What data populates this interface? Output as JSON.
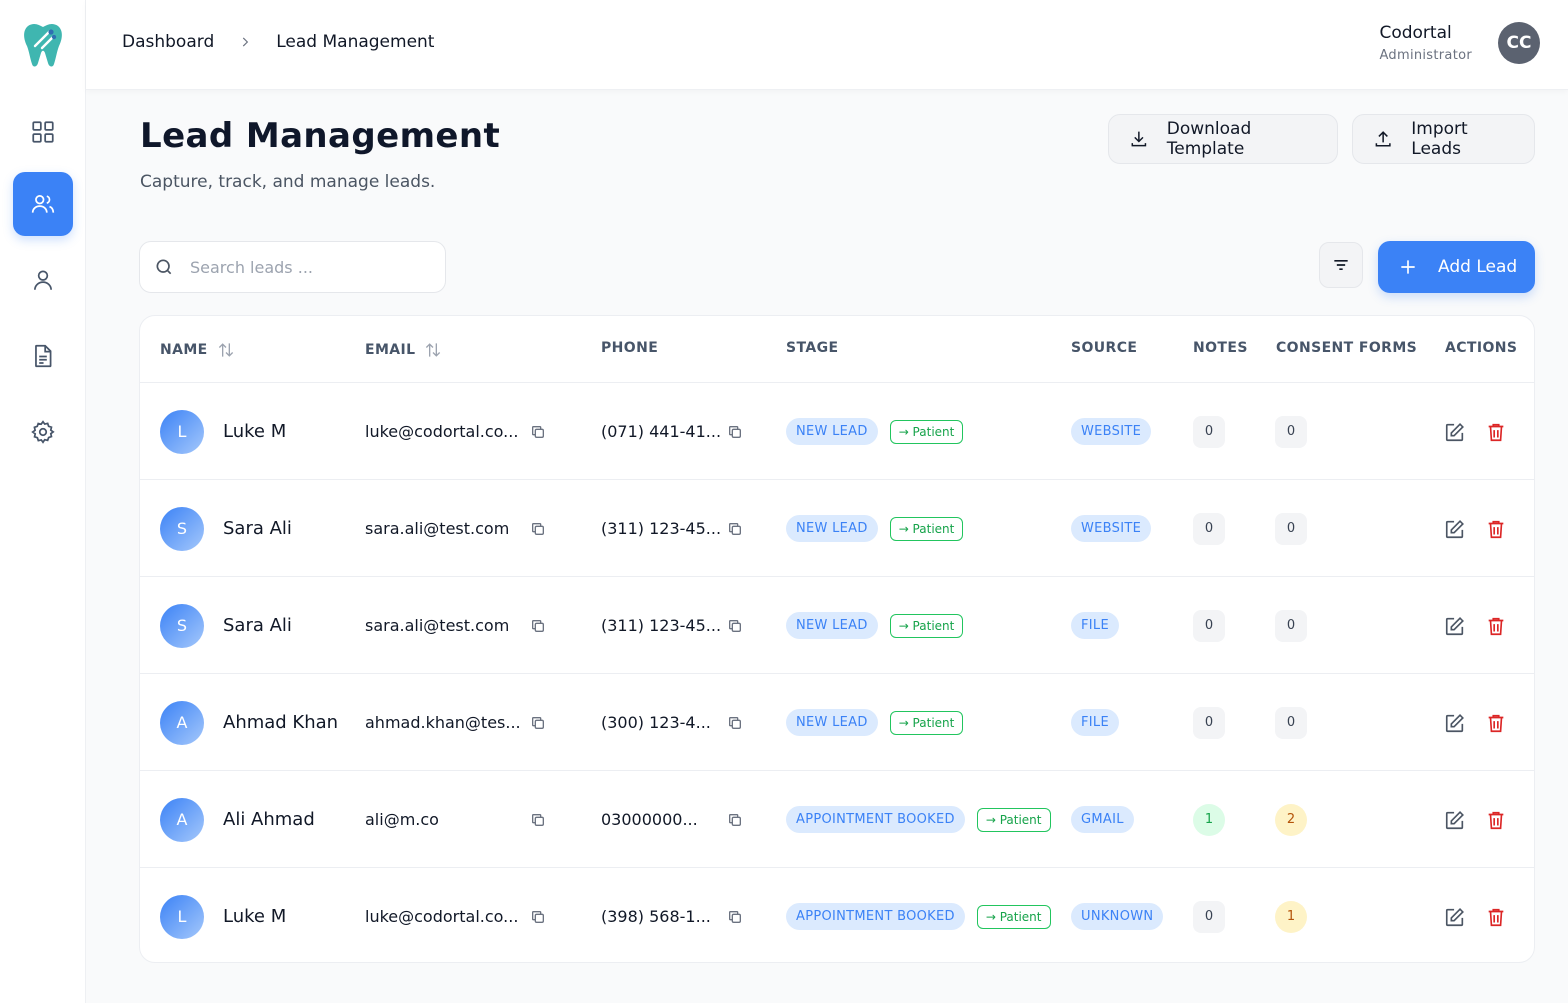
{
  "header": {
    "breadcrumb": [
      "Dashboard",
      "Lead Management"
    ],
    "user": {
      "name": "Codortal",
      "role": "Administrator",
      "initials": "CC"
    }
  },
  "sidebar": {
    "items": [
      {
        "name": "dashboard",
        "icon": "grid-icon",
        "active": false
      },
      {
        "name": "leads",
        "icon": "users-icon",
        "active": true
      },
      {
        "name": "patients",
        "icon": "user-icon",
        "active": false
      },
      {
        "name": "documents",
        "icon": "document-icon",
        "active": false
      },
      {
        "name": "settings",
        "icon": "gear-icon",
        "active": false
      }
    ]
  },
  "page": {
    "title": "Lead Management",
    "subtitle": "Capture, track, and manage leads.",
    "download_label": "Download Template",
    "import_label": "Import Leads",
    "add_label": "Add Lead"
  },
  "search": {
    "placeholder": "Search leads ...",
    "value": ""
  },
  "table": {
    "columns": [
      "NAME",
      "EMAIL",
      "PHONE",
      "STAGE",
      "SOURCE",
      "NOTES",
      "CONSENT FORMS",
      "ACTIONS"
    ],
    "rows": [
      {
        "initial": "L",
        "name": "Luke M",
        "email": "luke@codortal.co...",
        "phone": "(071) 441-41...",
        "stage": "NEW LEAD",
        "patient": "→ Patient",
        "source": "WEBSITE",
        "notes": "0",
        "consent": "0"
      },
      {
        "initial": "S",
        "name": "Sara Ali",
        "email": "sara.ali@test.com",
        "phone": "(311) 123-45...",
        "stage": "NEW LEAD",
        "patient": "→ Patient",
        "source": "WEBSITE",
        "notes": "0",
        "consent": "0"
      },
      {
        "initial": "S",
        "name": "Sara Ali",
        "email": "sara.ali@test.com",
        "phone": "(311) 123-45...",
        "stage": "NEW LEAD",
        "patient": "→ Patient",
        "source": "FILE",
        "notes": "0",
        "consent": "0"
      },
      {
        "initial": "A",
        "name": "Ahmad Khan",
        "email": "ahmad.khan@tes...",
        "phone": "(300) 123-4...",
        "stage": "NEW LEAD",
        "patient": "→ Patient",
        "source": "FILE",
        "notes": "0",
        "consent": "0"
      },
      {
        "initial": "A",
        "name": "Ali Ahmad",
        "email": "ali@m.co",
        "phone": "03000000...",
        "stage": "APPOINTMENT BOOKED",
        "patient": "→ Patient",
        "source": "GMAIL",
        "notes": "1",
        "consent": "2"
      },
      {
        "initial": "L",
        "name": "Luke M",
        "email": "luke@codortal.co...",
        "phone": "(398) 568-1...",
        "stage": "APPOINTMENT BOOKED",
        "patient": "→ Patient",
        "source": "UNKNOWN",
        "notes": "0",
        "consent": "1"
      }
    ]
  },
  "colors": {
    "accent": "#3b82f6",
    "danger": "#dc2626",
    "success": "#16a34a",
    "warning": "#b45309"
  }
}
